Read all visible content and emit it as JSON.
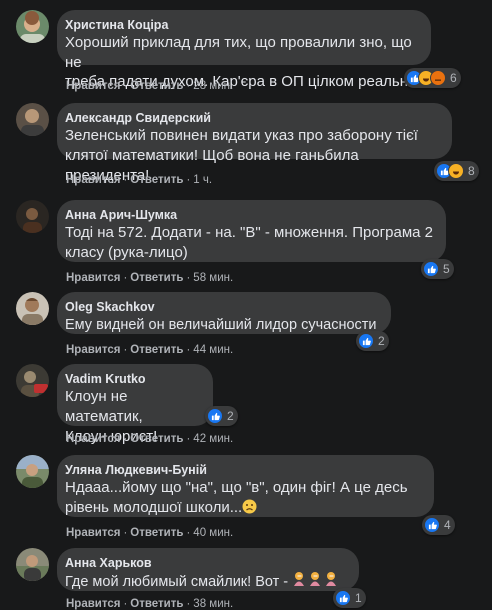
{
  "action_labels": {
    "like": "Нравится",
    "reply": "Ответить"
  },
  "comments": [
    {
      "author": "Христина Коціра",
      "lines": [
        "Хороший приклад для тих, що провалили зно, що не",
        "треба падати духом. Кар'єра в ОП цілком реальна"
      ],
      "time": "28 мин.",
      "reaction_count": "6",
      "reactions": [
        "like",
        "haha",
        "angry-icon"
      ]
    },
    {
      "author": "Александр Свидерский",
      "lines": [
        "Зеленський повинен видати указ про заборону тієї",
        "клятої математики! Щоб вона не ганьбила президента!"
      ],
      "time": "1 ч.",
      "reaction_count": "8",
      "reactions": [
        "like",
        "haha"
      ]
    },
    {
      "author": "Анна Арич-Шумка",
      "lines": [
        "Тоді на 572. Додати - на. \"В\" - множення. Програма 2",
        "класу (рука-лицо)"
      ],
      "time": "58 мин.",
      "reaction_count": "5",
      "reactions": [
        "like"
      ]
    },
    {
      "author": "Oleg Skachkov",
      "lines": [
        "Ему видней он величайший лидор сучасности"
      ],
      "time": "44 мин.",
      "reaction_count": "2",
      "reactions": [
        "like"
      ]
    },
    {
      "author": "Vadim Krutko",
      "lines": [
        "Клоун не математик,",
        "Клоун юрист!"
      ],
      "time": "42 мин.",
      "reaction_count": "2",
      "reactions": [
        "like"
      ]
    },
    {
      "author": "Уляна Людкевич-Буній",
      "lines": [
        "Ндааа...йому що \"на\", що \"в\", один фіг! А це десь",
        "рівень молодшої школи..."
      ],
      "time": "40 мин.",
      "reaction_count": "4",
      "reactions": [
        "like"
      ],
      "trailing_emoji": "sad-face-icon"
    },
    {
      "author": "Анна Харьков",
      "lines": [
        "Где мой любимый смайлик! Вот - "
      ],
      "time": "38 мин.",
      "reaction_count": "1",
      "reactions": [
        "like"
      ],
      "trailing_emoji": "facepalm-woman-icon"
    }
  ]
}
